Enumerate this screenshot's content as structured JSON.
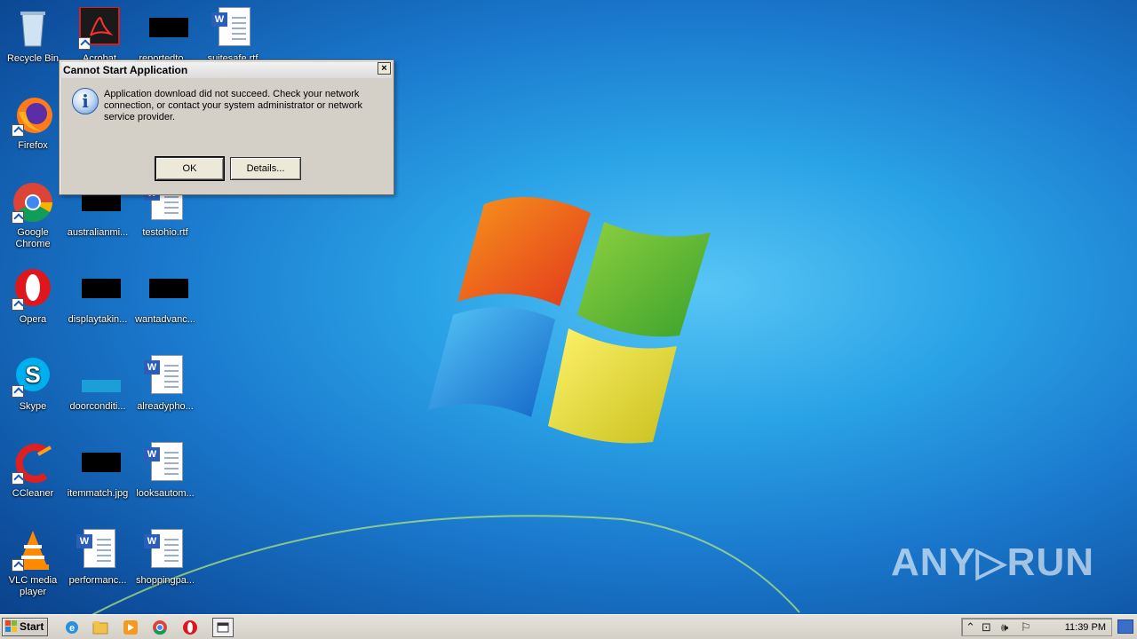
{
  "desktop": {
    "icons": [
      {
        "label": "Recycle Bin"
      },
      {
        "label": "Acrobat"
      },
      {
        "label": "reportedto..."
      },
      {
        "label": "suitesafe.rtf"
      },
      {
        "label": "Firefox"
      },
      {
        "label": "Google Chrome"
      },
      {
        "label": "australianmi..."
      },
      {
        "label": "testohio.rtf"
      },
      {
        "label": "Opera"
      },
      {
        "label": "displaytakin..."
      },
      {
        "label": "wantadvanc..."
      },
      {
        "label": "Skype"
      },
      {
        "label": "doorconditi..."
      },
      {
        "label": "alreadypho..."
      },
      {
        "label": "CCleaner"
      },
      {
        "label": "itemmatch.jpg"
      },
      {
        "label": "looksautom..."
      },
      {
        "label": "VLC media player"
      },
      {
        "label": "performanc..."
      },
      {
        "label": "shoppingpa..."
      }
    ]
  },
  "dialog": {
    "title": "Cannot Start Application",
    "close_label": "×",
    "message": "Application download did not succeed. Check your network connection, or contact your system administrator or network service provider.",
    "ok_label": "OK",
    "details_label": "Details..."
  },
  "taskbar": {
    "start_label": "Start",
    "clock": "11:39 PM",
    "pinned": [
      "internet-explorer-icon",
      "explorer-icon",
      "media-player-icon",
      "chrome-icon",
      "opera-icon",
      "app-window-icon"
    ]
  },
  "watermark": "ANY▷RUN",
  "colors": {
    "desktop_blue": "#1a78cc",
    "taskbar": "#d4d0c8"
  }
}
